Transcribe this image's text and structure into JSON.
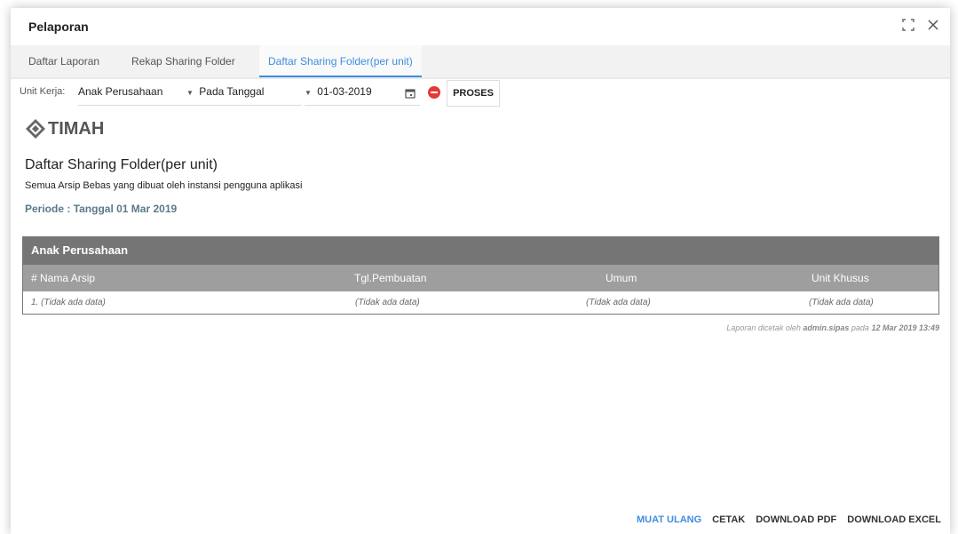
{
  "window": {
    "title": "Pelaporan"
  },
  "tabs": [
    {
      "label": "Daftar Laporan",
      "active": false
    },
    {
      "label": "Rekap Sharing Folder",
      "active": false
    },
    {
      "label": "Daftar Sharing Folder(per unit)",
      "active": true
    }
  ],
  "filter": {
    "unit_label": "Unit Kerja:",
    "unit_value": "Anak Perusahaan",
    "mode_value": "Pada Tanggal",
    "date_value": "01-03-2019",
    "proses_label": "PROSES"
  },
  "report": {
    "logo_text": "TIMAH",
    "title": "Daftar Sharing Folder(per unit)",
    "subtitle": "Semua Arsip Bebas yang dibuat oleh instansi pengguna aplikasi",
    "period": "Periode : Tanggal 01 Mar 2019"
  },
  "table": {
    "group_header": "Anak Perusahaan",
    "columns": [
      "# Nama Arsip",
      "Tgl.Pembuatan",
      "Umum",
      "Unit Khusus"
    ],
    "rows": [
      [
        "1. (Tidak ada data)",
        "(Tidak ada data)",
        "(Tidak ada data)",
        "(Tidak ada data)"
      ]
    ]
  },
  "footer_note": {
    "prefix": "Laporan dicetak oleh ",
    "user": "admin.sipas",
    "mid": " pada ",
    "datetime": "12 Mar 2019 13:49"
  },
  "actions": {
    "reload": "MUAT ULANG",
    "print": "CETAK",
    "pdf": "DOWNLOAD PDF",
    "excel": "DOWNLOAD EXCEL"
  },
  "colors": {
    "accent": "#3d8de0",
    "header_dark": "#757575",
    "header_light": "#9e9e9e",
    "danger": "#e53935"
  }
}
